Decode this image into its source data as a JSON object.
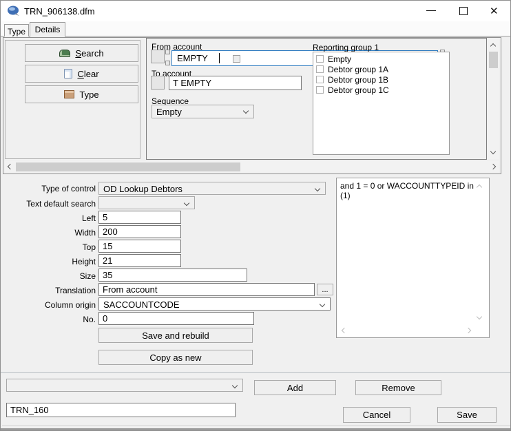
{
  "window": {
    "title": "TRN_906138.dfm"
  },
  "tabs": {
    "type": "Type",
    "details": "Details"
  },
  "side": {
    "search": "Search",
    "clear": "Clear",
    "type": "Type"
  },
  "top_form": {
    "from_account_label": "From account",
    "from_account_value": "EMPTY",
    "to_account_label": "To account",
    "to_account_value": "T EMPTY",
    "sequence_label": "Sequence",
    "sequence_value": "Empty",
    "reporting_group_label": "Reporting group 1",
    "reporting_items": [
      "Empty",
      "Debtor group 1A",
      "Debtor group 1B",
      "Debtor group 1C"
    ]
  },
  "detail_form": {
    "type_of_control_label": "Type of control",
    "type_of_control_value": "OD Lookup Debtors",
    "text_default_search_label": "Text default search",
    "text_default_search_value": "",
    "left_label": "Left",
    "left_value": "5",
    "width_label": "Width",
    "width_value": "200",
    "top_label": "Top",
    "top_value": "15",
    "height_label": "Height",
    "height_value": "21",
    "size_label": "Size",
    "size_value": "35",
    "translation_label": "Translation",
    "translation_value": "From account",
    "browse_label": "...",
    "column_origin_label": "Column origin",
    "column_origin_value": "SACCOUNTCODE",
    "no_label": "No.",
    "no_value": "0",
    "save_and_rebuild_label": "Save and rebuild",
    "copy_as_new_label": "Copy as new",
    "filter_text": "and 1 = 0 or WACCOUNTTYPEID in (1)"
  },
  "bottom": {
    "add_label": "Add",
    "remove_label": "Remove",
    "cancel_label": "Cancel",
    "save_label": "Save",
    "name_value": "TRN_160"
  },
  "colors": {
    "selection_border": "#2e7bc0",
    "divider": "#b5bcc1",
    "titlebar": "#ffffff"
  }
}
